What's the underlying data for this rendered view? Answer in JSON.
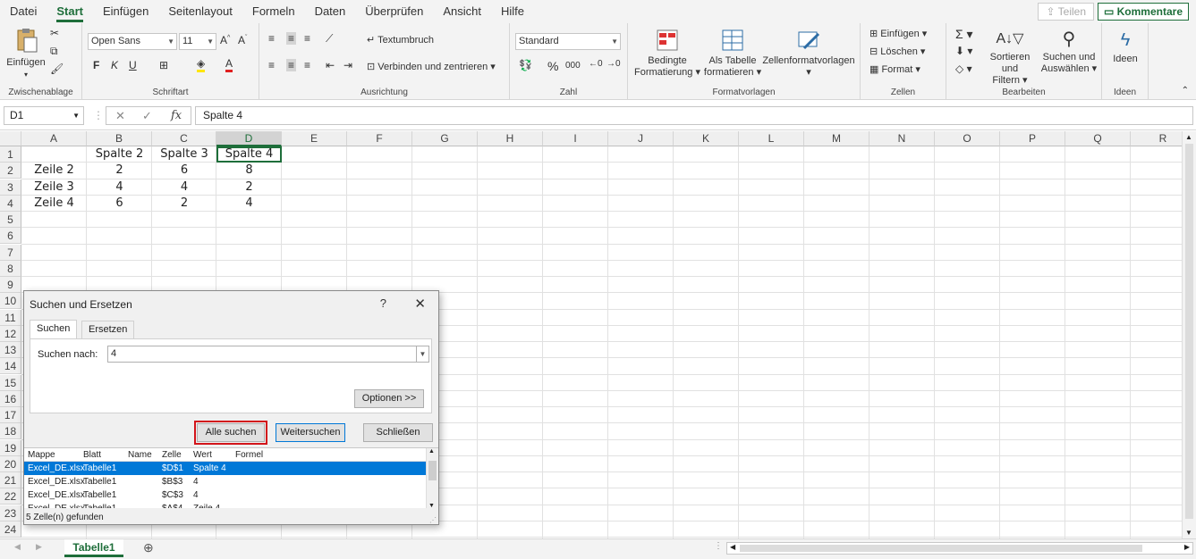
{
  "menu": {
    "items": [
      "Datei",
      "Start",
      "Einfügen",
      "Seitenlayout",
      "Formeln",
      "Daten",
      "Überprüfen",
      "Ansicht",
      "Hilfe"
    ],
    "share": "Teilen",
    "comments": "Kommentare"
  },
  "ribbon": {
    "clipboard": {
      "label": "Zwischenablage",
      "paste": "Einfügen"
    },
    "font": {
      "label": "Schriftart",
      "name": "Open Sans",
      "size": "11",
      "bold": "F",
      "italic": "K",
      "underline": "U"
    },
    "alignment": {
      "label": "Ausrichtung",
      "wrap": "Textumbruch",
      "merge": "Verbinden und zentrieren"
    },
    "number": {
      "label": "Zahl",
      "format": "Standard",
      "percent": "%",
      "comma": "000"
    },
    "styles": {
      "label": "Formatvorlagen",
      "conditional": "Bedingte",
      "conditional2": "Formatierung",
      "table": "Als Tabelle",
      "table2": "formatieren",
      "cellstyles": "Zellenformatvorlagen"
    },
    "cells": {
      "label": "Zellen",
      "insert": "Einfügen",
      "delete": "Löschen",
      "format": "Format"
    },
    "editing": {
      "label": "Bearbeiten",
      "sort": "Sortieren und",
      "sort2": "Filtern",
      "find": "Suchen und",
      "find2": "Auswählen"
    },
    "ideas": {
      "label": "Ideen",
      "button": "Ideen"
    }
  },
  "formula_bar": {
    "name_box": "D1",
    "fx": "fx",
    "content": "Spalte 4"
  },
  "grid": {
    "columns": [
      "A",
      "B",
      "C",
      "D",
      "E",
      "F",
      "G",
      "H",
      "I",
      "J",
      "K",
      "L",
      "M",
      "N",
      "O",
      "P",
      "Q",
      "R"
    ],
    "rows": [
      "1",
      "2",
      "3",
      "4",
      "5",
      "6",
      "7",
      "8",
      "9",
      "10",
      "11",
      "12",
      "13",
      "14",
      "15",
      "16",
      "17",
      "18",
      "19",
      "20",
      "21",
      "22",
      "23",
      "24"
    ],
    "data": {
      "B1": "Spalte 2",
      "C1": "Spalte 3",
      "D1": "Spalte 4",
      "A2": "Zeile 2",
      "B2": "2",
      "C2": "6",
      "D2": "8",
      "A3": "Zeile 3",
      "B3": "4",
      "C3": "4",
      "D3": "2",
      "A4": "Zeile 4",
      "B4": "6",
      "C4": "2",
      "D4": "4"
    }
  },
  "sheet": {
    "tab": "Tabelle1"
  },
  "dialog": {
    "title": "Suchen und Ersetzen",
    "help": "?",
    "close": "✕",
    "tabs": [
      "Suchen",
      "Ersetzen"
    ],
    "find_label": "Suchen nach:",
    "find_value": "4",
    "options": "Optionen >>",
    "find_all": "Alle suchen",
    "find_next": "Weitersuchen",
    "close_btn": "Schließen",
    "results_headers": [
      "Mappe",
      "Blatt",
      "Name",
      "Zelle",
      "Wert",
      "Formel"
    ],
    "results": [
      [
        "Excel_DE.xlsx",
        "Tabelle1",
        "",
        "$D$1",
        "Spalte 4",
        ""
      ],
      [
        "Excel_DE.xlsx",
        "Tabelle1",
        "",
        "$B$3",
        "4",
        ""
      ],
      [
        "Excel_DE.xlsx",
        "Tabelle1",
        "",
        "$C$3",
        "4",
        ""
      ],
      [
        "Excel_DE.xlsx",
        "Tabelle1",
        "",
        "$A$4",
        "Zeile 4",
        ""
      ]
    ],
    "status": "5 Zelle(n) gefunden"
  },
  "colors": {
    "accent": "#1e6e3a",
    "selection": "#0078d7",
    "highlight": "#d2141a"
  }
}
